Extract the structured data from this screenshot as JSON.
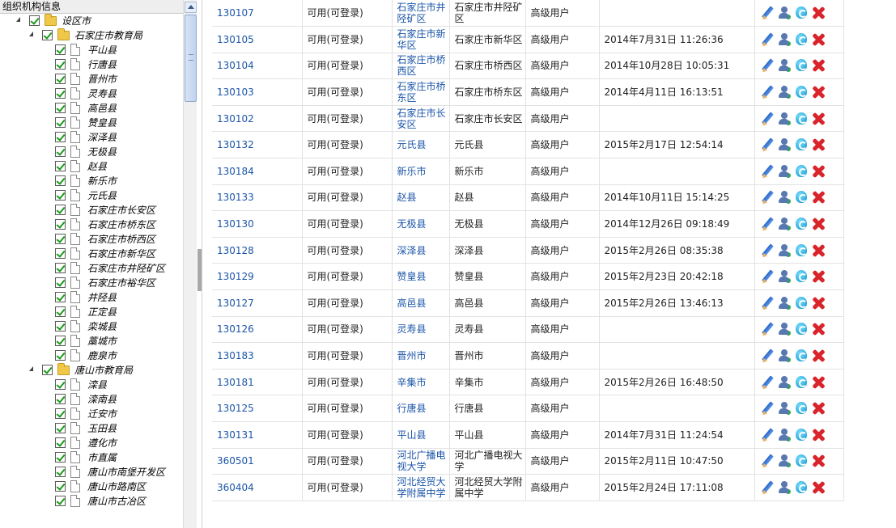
{
  "tree_panel": {
    "title": "组织机构信息",
    "nodes": [
      {
        "label": "设区市",
        "kind": "folder",
        "level": 1,
        "expanded": true
      },
      {
        "label": "石家庄市教育局",
        "kind": "folder",
        "level": 2,
        "expanded": true
      },
      {
        "label": "平山县",
        "kind": "page",
        "level": 3
      },
      {
        "label": "行唐县",
        "kind": "page",
        "level": 3
      },
      {
        "label": "晋州市",
        "kind": "page",
        "level": 3
      },
      {
        "label": "灵寿县",
        "kind": "page",
        "level": 3
      },
      {
        "label": "高邑县",
        "kind": "page",
        "level": 3
      },
      {
        "label": "赞皇县",
        "kind": "page",
        "level": 3
      },
      {
        "label": "深泽县",
        "kind": "page",
        "level": 3
      },
      {
        "label": "无极县",
        "kind": "page",
        "level": 3
      },
      {
        "label": "赵县",
        "kind": "page",
        "level": 3
      },
      {
        "label": "新乐市",
        "kind": "page",
        "level": 3
      },
      {
        "label": "元氏县",
        "kind": "page",
        "level": 3
      },
      {
        "label": "石家庄市长安区",
        "kind": "page",
        "level": 3
      },
      {
        "label": "石家庄市桥东区",
        "kind": "page",
        "level": 3
      },
      {
        "label": "石家庄市桥西区",
        "kind": "page",
        "level": 3
      },
      {
        "label": "石家庄市新华区",
        "kind": "page",
        "level": 3
      },
      {
        "label": "石家庄市井陉矿区",
        "kind": "page",
        "level": 3
      },
      {
        "label": "石家庄市裕华区",
        "kind": "page",
        "level": 3
      },
      {
        "label": "井陉县",
        "kind": "page",
        "level": 3
      },
      {
        "label": "正定县",
        "kind": "page",
        "level": 3
      },
      {
        "label": "栾城县",
        "kind": "page",
        "level": 3
      },
      {
        "label": "藁城市",
        "kind": "page",
        "level": 3
      },
      {
        "label": "鹿泉市",
        "kind": "page",
        "level": 3
      },
      {
        "label": "唐山市教育局",
        "kind": "folder",
        "level": 2,
        "expanded": true
      },
      {
        "label": "滦县",
        "kind": "page",
        "level": 3
      },
      {
        "label": "滦南县",
        "kind": "page",
        "level": 3
      },
      {
        "label": "迁安市",
        "kind": "page",
        "level": 3
      },
      {
        "label": "玉田县",
        "kind": "page",
        "level": 3
      },
      {
        "label": "遵化市",
        "kind": "page",
        "level": 3
      },
      {
        "label": "市直属",
        "kind": "page",
        "level": 3
      },
      {
        "label": "唐山市南堡开发区",
        "kind": "page",
        "level": 3
      },
      {
        "label": "唐山市路南区",
        "kind": "page",
        "level": 3
      },
      {
        "label": "唐山市古冶区",
        "kind": "page",
        "level": 3
      }
    ]
  },
  "table": {
    "rows": [
      {
        "code": "130107",
        "status": "可用(可登录)",
        "name": "石家庄市井陉矿区",
        "org": "石家庄市井陉矿区",
        "role": "高级用户",
        "time": ""
      },
      {
        "code": "130105",
        "status": "可用(可登录)",
        "name": "石家庄市新华区",
        "org": "石家庄市新华区",
        "role": "高级用户",
        "time": "2014年7月31日  11:26:36"
      },
      {
        "code": "130104",
        "status": "可用(可登录)",
        "name": "石家庄市桥西区",
        "org": "石家庄市桥西区",
        "role": "高级用户",
        "time": "2014年10月28日  10:05:31"
      },
      {
        "code": "130103",
        "status": "可用(可登录)",
        "name": "石家庄市桥东区",
        "org": "石家庄市桥东区",
        "role": "高级用户",
        "time": "2014年4月11日  16:13:51"
      },
      {
        "code": "130102",
        "status": "可用(可登录)",
        "name": "石家庄市长安区",
        "org": "石家庄市长安区",
        "role": "高级用户",
        "time": ""
      },
      {
        "code": "130132",
        "status": "可用(可登录)",
        "name": "元氏县",
        "org": "元氏县",
        "role": "高级用户",
        "time": "2015年2月17日  12:54:14"
      },
      {
        "code": "130184",
        "status": "可用(可登录)",
        "name": "新乐市",
        "org": "新乐市",
        "role": "高级用户",
        "time": ""
      },
      {
        "code": "130133",
        "status": "可用(可登录)",
        "name": "赵县",
        "org": "赵县",
        "role": "高级用户",
        "time": "2014年10月11日  15:14:25"
      },
      {
        "code": "130130",
        "status": "可用(可登录)",
        "name": "无极县",
        "org": "无极县",
        "role": "高级用户",
        "time": "2014年12月26日  09:18:49"
      },
      {
        "code": "130128",
        "status": "可用(可登录)",
        "name": "深泽县",
        "org": "深泽县",
        "role": "高级用户",
        "time": "2015年2月26日  08:35:38"
      },
      {
        "code": "130129",
        "status": "可用(可登录)",
        "name": "赞皇县",
        "org": "赞皇县",
        "role": "高级用户",
        "time": "2015年2月23日  20:42:18"
      },
      {
        "code": "130127",
        "status": "可用(可登录)",
        "name": "高邑县",
        "org": "高邑县",
        "role": "高级用户",
        "time": "2015年2月26日  13:46:13"
      },
      {
        "code": "130126",
        "status": "可用(可登录)",
        "name": "灵寿县",
        "org": "灵寿县",
        "role": "高级用户",
        "time": ""
      },
      {
        "code": "130183",
        "status": "可用(可登录)",
        "name": "晋州市",
        "org": "晋州市",
        "role": "高级用户",
        "time": ""
      },
      {
        "code": "130181",
        "status": "可用(可登录)",
        "name": "辛集市",
        "org": "辛集市",
        "role": "高级用户",
        "time": "2015年2月26日  16:48:50"
      },
      {
        "code": "130125",
        "status": "可用(可登录)",
        "name": "行唐县",
        "org": "行唐县",
        "role": "高级用户",
        "time": ""
      },
      {
        "code": "130131",
        "status": "可用(可登录)",
        "name": "平山县",
        "org": "平山县",
        "role": "高级用户",
        "time": "2014年7月31日  11:24:54"
      },
      {
        "code": "360501",
        "status": "可用(可登录)",
        "name": "河北广播电视大学",
        "org": "河北广播电视大学",
        "role": "高级用户",
        "time": "2015年2月11日  10:47:50"
      },
      {
        "code": "360404",
        "status": "可用(可登录)",
        "name": "河北经贸大学附属中学",
        "org": "河北经贸大学附属中学",
        "role": "高级用户",
        "time": "2015年2月24日  17:11:08"
      }
    ],
    "row_actions": [
      "pencil-edit-icon",
      "user-permission-icon",
      "shield-reset-icon",
      "red-x-delete-icon"
    ]
  },
  "colors": {
    "link": "#1b55a8",
    "check": "#1a9a1a",
    "delete": "#d8242a",
    "folder": "#f0c848",
    "header_bg": "#eeeeee"
  }
}
